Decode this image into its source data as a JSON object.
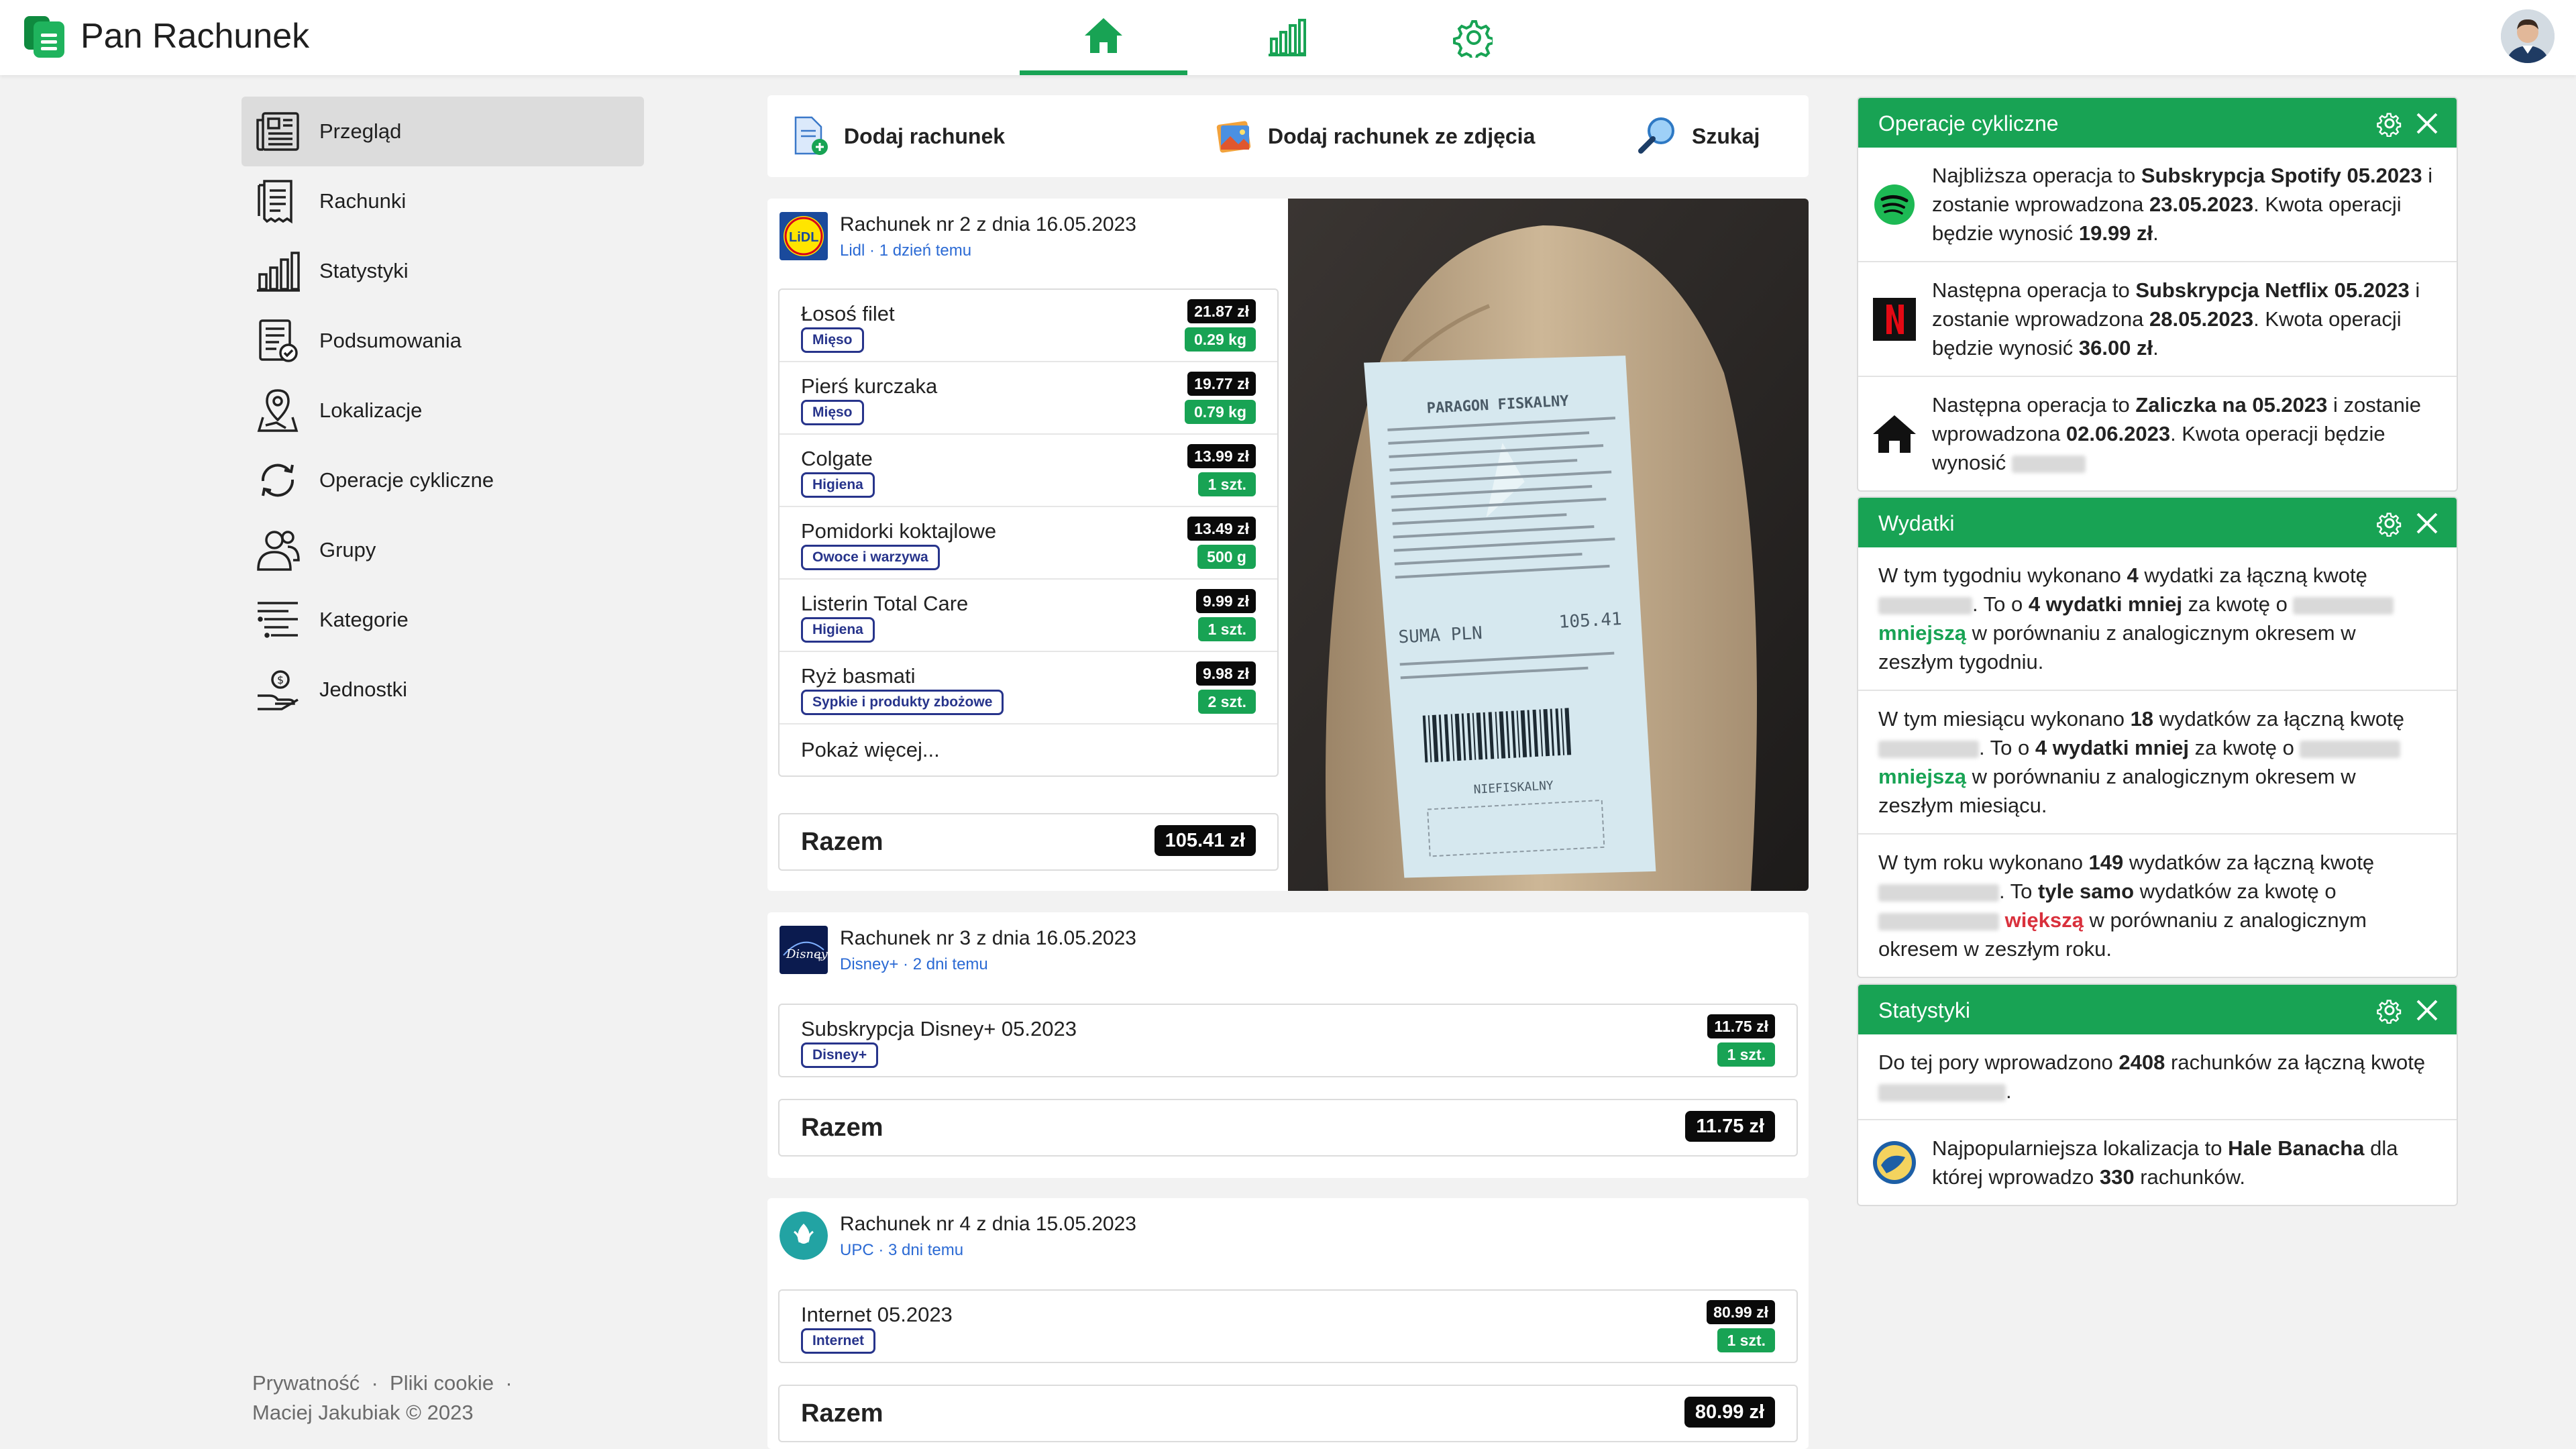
{
  "app": {
    "title": "Pan Rachunek"
  },
  "nav": {
    "tabs": [
      "home",
      "stats",
      "settings"
    ]
  },
  "sidebar": {
    "items": [
      {
        "label": "Przegląd",
        "icon": "newspaper-icon",
        "active": true
      },
      {
        "label": "Rachunki",
        "icon": "receipt-icon"
      },
      {
        "label": "Statystyki",
        "icon": "bar-chart-icon"
      },
      {
        "label": "Podsumowania",
        "icon": "checklist-icon"
      },
      {
        "label": "Lokalizacje",
        "icon": "map-pin-icon"
      },
      {
        "label": "Operacje cykliczne",
        "icon": "cycle-arrows-icon"
      },
      {
        "label": "Grupy",
        "icon": "group-icon"
      },
      {
        "label": "Kategorie",
        "icon": "categories-icon"
      },
      {
        "label": "Jednostki",
        "icon": "units-icon"
      }
    ]
  },
  "footer": {
    "privacy": "Prywatność",
    "cookies": "Pliki cookie",
    "sep": "·",
    "copyright": "Maciej Jakubiak © 2023"
  },
  "actions": {
    "add": "Dodaj rachunek",
    "add_photo": "Dodaj rachunek ze zdjęcia",
    "search": "Szukaj"
  },
  "receipts": [
    {
      "title": "Rachunek nr 2 z dnia 16.05.2023",
      "sub": "Lidl · 1 dzień temu",
      "items": [
        {
          "name": "Łosoś filet",
          "tag": "Mięso",
          "price": "21.87 zł",
          "qty": "0.29 kg"
        },
        {
          "name": "Pierś kurczaka",
          "tag": "Mięso",
          "price": "19.77 zł",
          "qty": "0.79 kg"
        },
        {
          "name": "Colgate",
          "tag": "Higiena",
          "price": "13.99 zł",
          "qty": "1 szt."
        },
        {
          "name": "Pomidorki koktajlowe",
          "tag": "Owoce i warzywa",
          "price": "13.49 zł",
          "qty": "500 g"
        },
        {
          "name": "Listerin Total Care",
          "tag": "Higiena",
          "price": "9.99 zł",
          "qty": "1 szt."
        },
        {
          "name": "Ryż basmati",
          "tag": "Sypkie i produkty zbożowe",
          "price": "9.98 zł",
          "qty": "2 szt."
        }
      ],
      "show_more": "Pokaż więcej...",
      "total_label": "Razem",
      "total": "105.41 zł"
    },
    {
      "title": "Rachunek nr 3 z dnia 16.05.2023",
      "sub": "Disney+ · 2 dni temu",
      "items": [
        {
          "name": "Subskrypcja Disney+ 05.2023",
          "tag": "Disney+",
          "price": "11.75 zł",
          "qty": "1 szt."
        }
      ],
      "total_label": "Razem",
      "total": "11.75 zł"
    },
    {
      "title": "Rachunek nr 4 z dnia 15.05.2023",
      "sub": "UPC · 3 dni temu",
      "items": [
        {
          "name": "Internet 05.2023",
          "tag": "Internet",
          "price": "80.99 zł",
          "qty": "1 szt."
        }
      ],
      "total_label": "Razem",
      "total": "80.99 zł"
    }
  ],
  "receipt_photo": {
    "header": "PARAGON FISKALNY",
    "sum_label": "SUMA PLN",
    "sum": "105.41",
    "nonfiscal": "NIEFISKALNY"
  },
  "widgets": {
    "cyclic": {
      "title": "Operacje cykliczne",
      "rows": [
        {
          "icon": "spotify-icon",
          "t1": "Najbliższa operacja to ",
          "b1": "Subskrypcja Spotify 05.2023",
          "t2": " i zostanie wprowadzona ",
          "b2": "23.05.2023",
          "t3": ". Kwota operacji będzie wynosić ",
          "b3": "19.99 zł",
          "t4": "."
        },
        {
          "icon": "netflix-icon",
          "t1": "Następna operacja to ",
          "b1": "Subskrypcja Netflix 05.2023",
          "t2": " i zostanie wprowadzona ",
          "b2": "28.05.2023",
          "t3": ". Kwota operacji będzie wynosić ",
          "b3": "36.00 zł",
          "t4": "."
        },
        {
          "icon": "house-icon",
          "t1": "Następna operacja to ",
          "b1": "Zaliczka na 05.2023",
          "t2": " i zostanie wprowadzona ",
          "b2": "02.06.2023",
          "t3": ". Kwota operacji będzie wynosić ",
          "b3": "",
          "t4": ""
        }
      ]
    },
    "expenses": {
      "title": "Wydatki",
      "rows": [
        {
          "a": "W tym tygodniu wykonano ",
          "n": "4",
          "b": " wydatki za łączną kwotę ",
          "c": ". To o ",
          "d": "4 wydatki mniej",
          "e": " za kwotę o ",
          "cmp": "mniejszą",
          "f": " w porównaniu z analogicznym okresem w zeszłym tygodniu."
        },
        {
          "a": "W tym miesiącu wykonano ",
          "n": "18",
          "b": " wydatków za łączną kwotę ",
          "c": ". To o ",
          "d": "4 wydatki mniej",
          "e": " za kwotę o ",
          "cmp": "mniejszą",
          "f": " w porównaniu z analogicznym okresem w zeszłym miesiącu."
        },
        {
          "a": "W tym roku wykonano ",
          "n": "149",
          "b": " wydatków za łączną kwotę ",
          "c": ". To ",
          "d": "tyle samo",
          "e": " wydatków za kwotę o ",
          "cmp": "większą",
          "f": " w porównaniu z analogicznym okresem w zeszłym roku."
        }
      ]
    },
    "stats": {
      "title": "Statystyki",
      "r1a": "Do tej pory wprowadzono ",
      "r1n": "2408",
      "r1b": " rachunków za łączną kwotę ",
      "r1c": ".",
      "r2a": "Najpopularniejsza lokalizacja to ",
      "r2b": "Hale Banacha",
      "r2c": " dla której wprowadzo ",
      "r2n": "330",
      "r2d": " rachunków."
    }
  },
  "colors": {
    "accent": "#18a354",
    "tag": "#27348b",
    "less": "#18a354",
    "more": "#d9303c",
    "link": "#2b6ad4"
  }
}
